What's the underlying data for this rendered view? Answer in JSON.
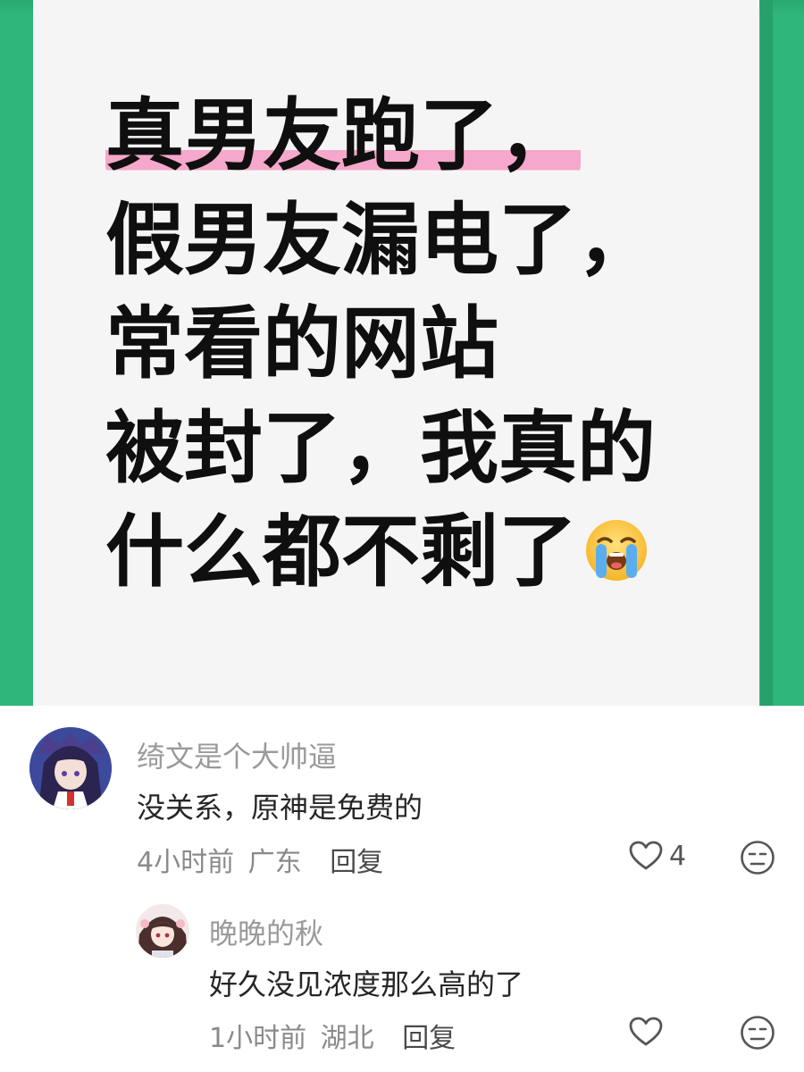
{
  "post": {
    "headline_lines": [
      "真男友跑了，",
      "假男友漏电了，",
      "常看的网站",
      "被封了，我真的",
      "什么都不剩了"
    ],
    "emoji": "loudly-crying-face",
    "colors": {
      "border": "#2fb67a",
      "highlight": "#f5a8cb",
      "card": "#f5f5f5"
    }
  },
  "comments": [
    {
      "username": "绮文是个大帅逼",
      "text": "没关系，原神是免费的",
      "time": "4小时前",
      "location": "广东",
      "reply_label": "回复",
      "likes": "4"
    },
    {
      "username": "晚晚的秋",
      "text": "好久没见浓度那么高的了",
      "time": "1小时前",
      "location": "湖北",
      "reply_label": "回复",
      "likes": ""
    }
  ]
}
